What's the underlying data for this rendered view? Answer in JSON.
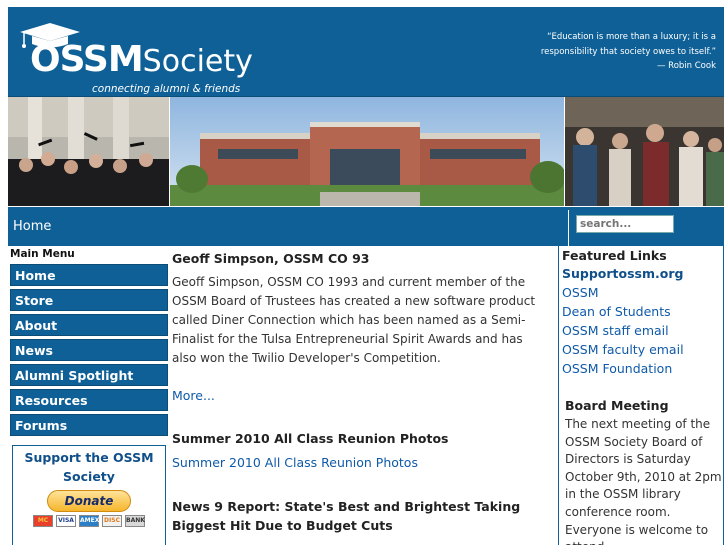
{
  "header": {
    "logo_main": "OSSM",
    "logo_secondary": "Society",
    "logo_tagline": "connecting alumni & friends",
    "quote_text": "“Education is more than a luxury; it is a responsibility that society owes to itself.”",
    "quote_author": "— Robin Cook"
  },
  "navbar": {
    "breadcrumb": "Home",
    "search_placeholder": "search..."
  },
  "menu": {
    "title": "Main Menu",
    "items": [
      "Home",
      "Store",
      "About",
      "News",
      "Alumni Spotlight",
      "Resources",
      "Forums"
    ]
  },
  "support": {
    "title": "Support the OSSM Society",
    "donate_label": "Donate",
    "cards": [
      "MC",
      "VISA",
      "AMEX",
      "DISC",
      "BANK"
    ]
  },
  "main": {
    "article1_title": "Geoff Simpson, OSSM CO 93",
    "article1_body": "Geoff Simpson, OSSM CO 1993 and current member of the OSSM Board of Trustees has created a new software product called Diner Connection which has been named as a Semi-Finalist for the Tulsa Entrepreneurial Spirit Awards and has also won the Twilio Developer's Competition.",
    "more_link": "More...",
    "article2_title": "Summer 2010 All Class Reunion Photos",
    "article2_link": "Summer 2010 All Class Reunion Photos",
    "article3_title": "News 9 Report: State's Best and Brightest Taking Biggest Hit Due to Budget Cuts"
  },
  "right": {
    "featured_title": "Featured Links",
    "links": [
      "Supportossm.org",
      "OSSM",
      "Dean of Students",
      "OSSM staff email",
      "OSSM faculty email",
      "OSSM Foundation"
    ],
    "board_title": "Board Meeting",
    "board_text": "The next meeting of the OSSM Society Board of Directors is Saturday October 9th, 2010 at 2pm in the OSSM library conference room. Everyone is welcome to attend."
  },
  "colors": {
    "brand_blue": "#0f6096",
    "link_blue": "#0f5aa8"
  }
}
